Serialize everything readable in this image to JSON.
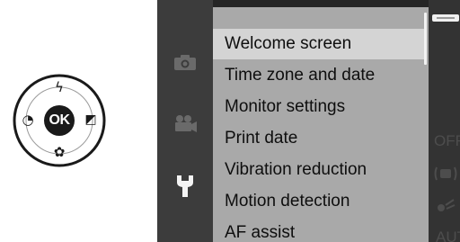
{
  "multi_selector": {
    "center_label": "OK",
    "up_glyph": "ϟ",
    "left_glyph": "◔",
    "right_glyph": "◩",
    "down_glyph": "✿",
    "up_icon": "flash-icon",
    "left_icon": "self-timer-icon",
    "right_icon": "exposure-compensation-icon",
    "down_icon": "macro-flower-icon"
  },
  "tabs": [
    {
      "icon": "camera-icon"
    },
    {
      "icon": "movie-camera-icon"
    },
    {
      "icon": "wrench-icon",
      "selected": true
    }
  ],
  "menu": {
    "items": [
      {
        "label": "Welcome screen",
        "selected": true
      },
      {
        "label": "Time zone and date"
      },
      {
        "label": "Monitor settings"
      },
      {
        "label": "Print date"
      },
      {
        "label": "Vibration reduction"
      },
      {
        "label": "Motion detection"
      },
      {
        "label": "AF assist"
      }
    ]
  },
  "side_values": {
    "print_date": "OFF",
    "af_assist": "AUTO"
  },
  "colors": {
    "screen_background": "#252525",
    "menu_background": "#a9a9a9",
    "selected_row": "#d4d4d4"
  }
}
